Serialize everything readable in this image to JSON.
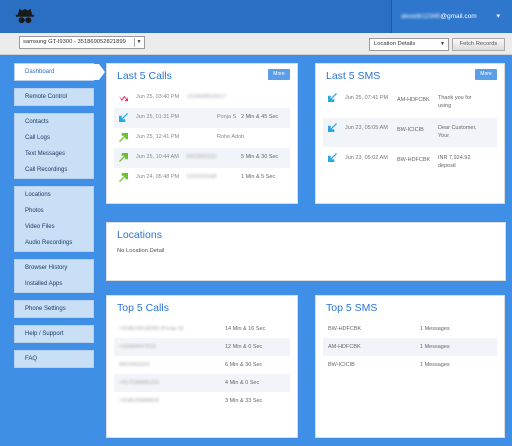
{
  "header": {
    "logo": "spy-hat-glasses-icon",
    "account_email_local": "akoodir12345",
    "account_email_domain": "@gmail.com",
    "account_caret": "▾"
  },
  "toolbar": {
    "device_value": "samsung GT-I9300 - 351869052821899",
    "location_select_value": "Location Details",
    "fetch_button": "Fetch Records"
  },
  "sidebar": {
    "groups": [
      [
        {
          "label": "Dashboard",
          "active": true
        }
      ],
      [
        {
          "label": "Remote Control"
        }
      ],
      [
        {
          "label": "Contacts"
        },
        {
          "label": "Call Logs"
        },
        {
          "label": "Text Messages"
        },
        {
          "label": "Call Recordings"
        }
      ],
      [
        {
          "label": "Locations"
        },
        {
          "label": "Photos"
        },
        {
          "label": "Video Files"
        },
        {
          "label": "Audio Recordings"
        }
      ],
      [
        {
          "label": "Browser History"
        },
        {
          "label": "Installed Apps"
        }
      ],
      [
        {
          "label": "Phone Settings"
        }
      ],
      [
        {
          "label": "Help / Support"
        }
      ],
      [
        {
          "label": "FAQ"
        }
      ]
    ]
  },
  "last_calls": {
    "title": "Last 5 Calls",
    "more_label": "More",
    "rows": [
      {
        "type": "missed",
        "date": "Jun 25, 03:40 PM",
        "number": "+918668534617",
        "name": "",
        "duration": ""
      },
      {
        "type": "incoming",
        "date": "Jun 25, 01:31 PM",
        "number": "",
        "name": "Pooja S",
        "duration": "2 Min & 45 Sec"
      },
      {
        "type": "outgoing",
        "date": "Jun 25, 12:41 PM",
        "number": "",
        "name": "Rohe Adob",
        "duration": ""
      },
      {
        "type": "outgoing",
        "date": "Jun 25, 10:44 AM",
        "number": "9903960333",
        "name": "",
        "duration": "5 Min & 30 Sec"
      },
      {
        "type": "outgoing",
        "date": "Jun 24, 05:48 PM",
        "number": "1303425448",
        "name": "",
        "duration": "1 Min & 5 Sec"
      }
    ]
  },
  "last_sms": {
    "title": "Last 5 SMS",
    "more_label": "More",
    "rows": [
      {
        "type": "incoming",
        "date": "Jun 25, 07:41 PM",
        "from": "AM-HDFCBK",
        "message": "Thank you for using"
      },
      {
        "type": "incoming",
        "date": "Jun 23, 05:05 AM",
        "from": "BW-ICICIB",
        "message": "Dear Customer, Your"
      },
      {
        "type": "incoming",
        "date": "Jun 23, 05:02 AM",
        "from": "BW-HDFCBK",
        "message": "INR 7,924.92 deposit"
      }
    ]
  },
  "locations": {
    "title": "Locations",
    "detail": "No Location Detail"
  },
  "top_calls": {
    "title": "Top 5 Calls",
    "rows": [
      {
        "number": "+918019618289 (Pooja S)",
        "duration": "14 Min & 16 Sec"
      },
      {
        "number": "+16684447615",
        "duration": "12 Min & 0 Sec"
      },
      {
        "number": "9903960333",
        "duration": "6 Min & 30 Sec"
      },
      {
        "number": "+917038885233",
        "duration": "4 Min & 0 Sec"
      },
      {
        "number": "+918025688839",
        "duration": "3 Min & 33 Sec"
      }
    ]
  },
  "top_sms": {
    "title": "Top 5 SMS",
    "rows": [
      {
        "sender": "BW-HDFCBK",
        "count": "1 Messages"
      },
      {
        "sender": "AM-HDFCBK",
        "count": "1 Messages"
      },
      {
        "sender": "BW-ICICIB",
        "count": "1 Messages"
      }
    ]
  },
  "colors": {
    "background": "#3f8fe6",
    "topbar": "#2a6fc2",
    "accent_title": "#2a75d6",
    "missed_arrow": "#e0306a",
    "incoming_arrow": "#29a9e1",
    "outgoing_arrow": "#6abf2e"
  }
}
